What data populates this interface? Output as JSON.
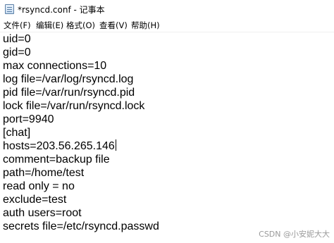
{
  "window": {
    "title": "*rsyncd.conf - 记事本",
    "icon": "notepad-icon"
  },
  "menu": {
    "items": [
      "文件(F)",
      "编辑(E)",
      "格式(O)",
      "查看(V)",
      "帮助(H)"
    ]
  },
  "editor": {
    "lines": [
      "uid=0",
      "gid=0",
      "max connections=10",
      "log file=/var/log/rsyncd.log",
      "pid file=/var/run/rsyncd.pid",
      "lock file=/var/run/rsyncd.lock",
      "port=9940",
      "[chat]",
      "hosts=203.56.265.146",
      "comment=backup file",
      "path=/home/test",
      "read only = no",
      "exclude=test",
      "auth users=root",
      "secrets file=/etc/rsyncd.passwd"
    ]
  },
  "watermark": "CSDN @小安妮大大"
}
